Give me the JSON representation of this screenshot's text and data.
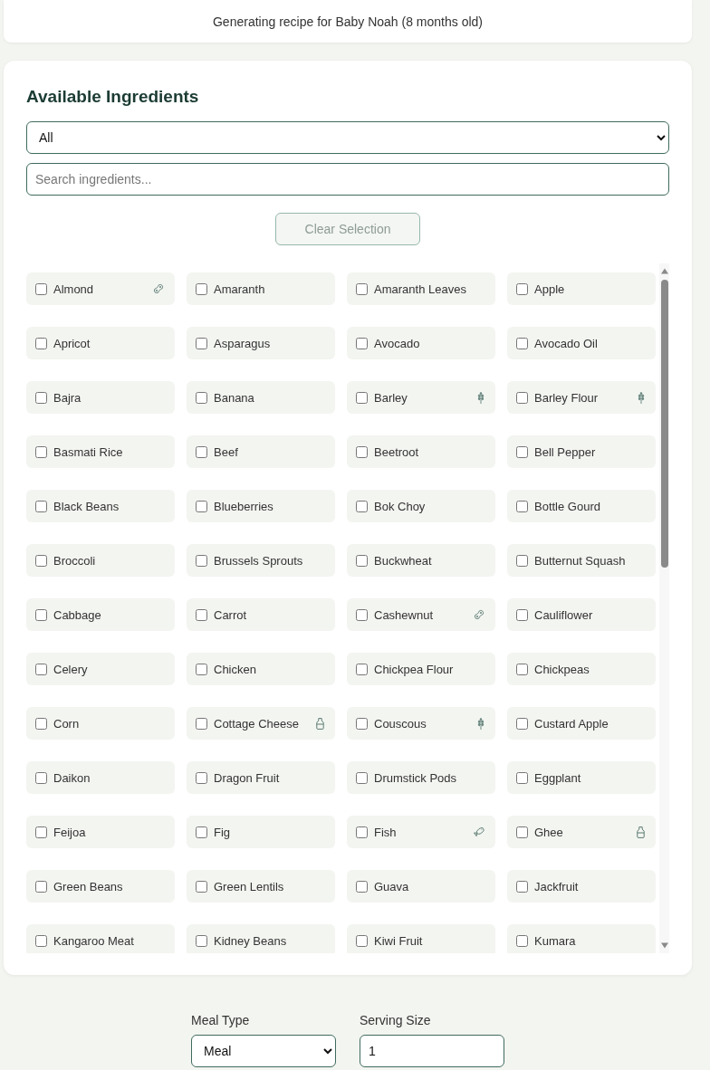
{
  "banner": {
    "text": "Generating recipe for Baby Noah (8 months old)"
  },
  "ingredients_panel": {
    "title": "Available Ingredients",
    "category_filter": {
      "value": "All"
    },
    "search": {
      "placeholder": "Search ingredients..."
    },
    "clear_button": {
      "label": "Clear Selection",
      "disabled": true
    },
    "items": [
      {
        "name": "Almond",
        "checked": false,
        "kind": "nut"
      },
      {
        "name": "Amaranth",
        "checked": false,
        "kind": "plain"
      },
      {
        "name": "Amaranth Leaves",
        "checked": false,
        "kind": "plain"
      },
      {
        "name": "Apple",
        "checked": false,
        "kind": "plain"
      },
      {
        "name": "Apricot",
        "checked": false,
        "kind": "plain"
      },
      {
        "name": "Asparagus",
        "checked": false,
        "kind": "plain"
      },
      {
        "name": "Avocado",
        "checked": false,
        "kind": "plain"
      },
      {
        "name": "Avocado Oil",
        "checked": false,
        "kind": "plain"
      },
      {
        "name": "Bajra",
        "checked": false,
        "kind": "plain"
      },
      {
        "name": "Banana",
        "checked": false,
        "kind": "plain"
      },
      {
        "name": "Barley",
        "checked": false,
        "kind": "grain"
      },
      {
        "name": "Barley Flour",
        "checked": false,
        "kind": "grain"
      },
      {
        "name": "Basmati Rice",
        "checked": false,
        "kind": "plain"
      },
      {
        "name": "Beef",
        "checked": false,
        "kind": "plain"
      },
      {
        "name": "Beetroot",
        "checked": false,
        "kind": "plain"
      },
      {
        "name": "Bell Pepper",
        "checked": false,
        "kind": "plain"
      },
      {
        "name": "Black Beans",
        "checked": false,
        "kind": "plain"
      },
      {
        "name": "Blueberries",
        "checked": false,
        "kind": "plain"
      },
      {
        "name": "Bok Choy",
        "checked": false,
        "kind": "plain"
      },
      {
        "name": "Bottle Gourd",
        "checked": false,
        "kind": "plain"
      },
      {
        "name": "Broccoli",
        "checked": false,
        "kind": "plain"
      },
      {
        "name": "Brussels Sprouts",
        "checked": false,
        "kind": "plain"
      },
      {
        "name": "Buckwheat",
        "checked": false,
        "kind": "plain"
      },
      {
        "name": "Butternut Squash",
        "checked": false,
        "kind": "plain"
      },
      {
        "name": "Cabbage",
        "checked": false,
        "kind": "plain"
      },
      {
        "name": "Carrot",
        "checked": false,
        "kind": "plain"
      },
      {
        "name": "Cashewnut",
        "checked": false,
        "kind": "nut"
      },
      {
        "name": "Cauliflower",
        "checked": false,
        "kind": "plain"
      },
      {
        "name": "Celery",
        "checked": false,
        "kind": "plain"
      },
      {
        "name": "Chicken",
        "checked": false,
        "kind": "plain"
      },
      {
        "name": "Chickpea Flour",
        "checked": false,
        "kind": "plain"
      },
      {
        "name": "Chickpeas",
        "checked": false,
        "kind": "plain"
      },
      {
        "name": "Corn",
        "checked": false,
        "kind": "plain"
      },
      {
        "name": "Cottage Cheese",
        "checked": false,
        "kind": "dairy"
      },
      {
        "name": "Couscous",
        "checked": false,
        "kind": "grain"
      },
      {
        "name": "Custard Apple",
        "checked": false,
        "kind": "plain"
      },
      {
        "name": "Daikon",
        "checked": false,
        "kind": "plain"
      },
      {
        "name": "Dragon Fruit",
        "checked": false,
        "kind": "plain"
      },
      {
        "name": "Drumstick Pods",
        "checked": false,
        "kind": "plain"
      },
      {
        "name": "Eggplant",
        "checked": false,
        "kind": "plain"
      },
      {
        "name": "Feijoa",
        "checked": false,
        "kind": "plain"
      },
      {
        "name": "Fig",
        "checked": false,
        "kind": "plain"
      },
      {
        "name": "Fish",
        "checked": false,
        "kind": "fish"
      },
      {
        "name": "Ghee",
        "checked": false,
        "kind": "dairy"
      },
      {
        "name": "Green Beans",
        "checked": false,
        "kind": "plain"
      },
      {
        "name": "Green Lentils",
        "checked": false,
        "kind": "plain"
      },
      {
        "name": "Guava",
        "checked": false,
        "kind": "plain"
      },
      {
        "name": "Jackfruit",
        "checked": false,
        "kind": "plain"
      },
      {
        "name": "Kangaroo Meat",
        "checked": false,
        "kind": "plain"
      },
      {
        "name": "Kidney Beans",
        "checked": false,
        "kind": "plain"
      },
      {
        "name": "Kiwi Fruit",
        "checked": false,
        "kind": "plain"
      },
      {
        "name": "Kumara",
        "checked": false,
        "kind": "plain"
      }
    ]
  },
  "meal_settings": {
    "meal_type": {
      "label": "Meal Type",
      "value": "Meal"
    },
    "serving_size": {
      "label": "Serving Size",
      "value": "1"
    }
  }
}
